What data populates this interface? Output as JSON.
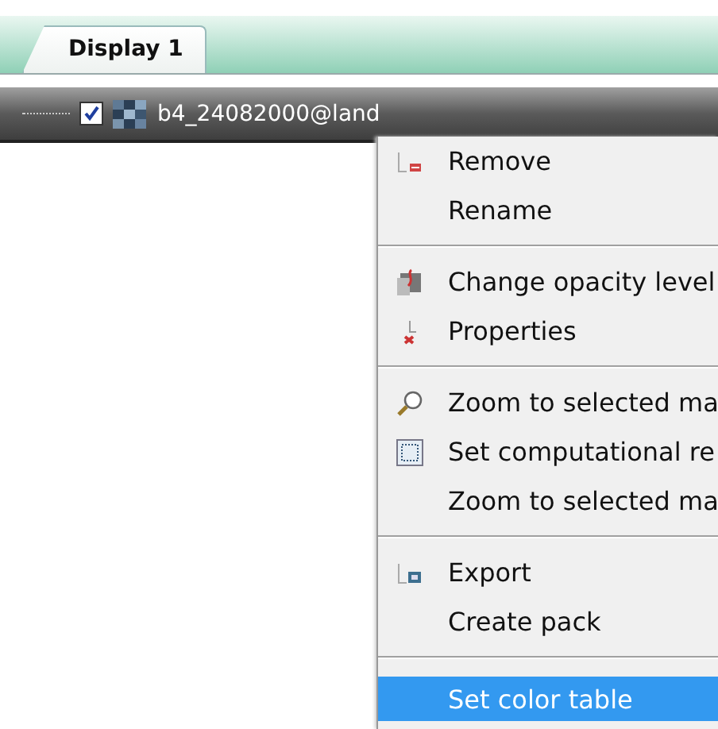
{
  "tabs": [
    {
      "label": "Display 1",
      "selected": true
    }
  ],
  "layer": {
    "name": "b4_24082000@land",
    "checked": true
  },
  "context_menu": {
    "items": [
      {
        "kind": "item",
        "label": "Remove",
        "selected": false
      },
      {
        "kind": "item",
        "label": "Rename",
        "selected": false
      },
      {
        "kind": "separator"
      },
      {
        "kind": "item",
        "label": "Change opacity level",
        "selected": false
      },
      {
        "kind": "item",
        "label": "Properties",
        "selected": false
      },
      {
        "kind": "separator"
      },
      {
        "kind": "item",
        "label": "Zoom to selected ma",
        "selected": false
      },
      {
        "kind": "item",
        "label": "Set computational re",
        "selected": false
      },
      {
        "kind": "item",
        "label": "Zoom to selected ma",
        "selected": false
      },
      {
        "kind": "separator"
      },
      {
        "kind": "item",
        "label": "Export",
        "selected": false
      },
      {
        "kind": "item",
        "label": "Create pack",
        "selected": false
      },
      {
        "kind": "separator"
      },
      {
        "kind": "item",
        "label": "Set color table",
        "selected": true
      }
    ]
  }
}
